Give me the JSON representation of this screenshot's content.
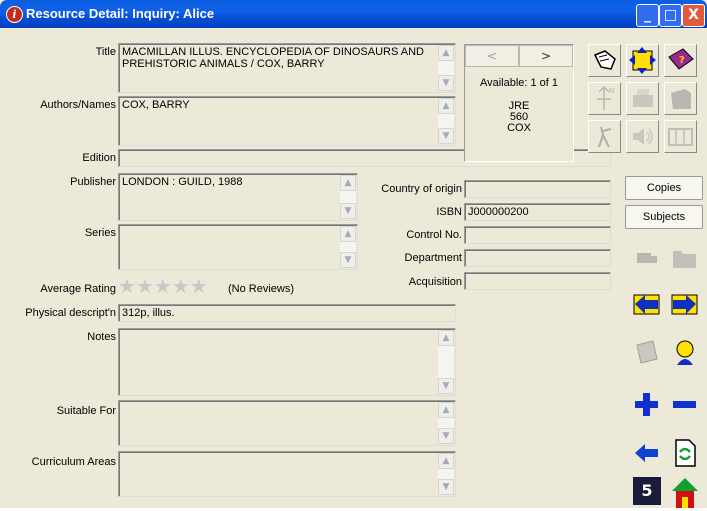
{
  "window": {
    "title": "Resource Detail: Inquiry: Alice",
    "minimize": "_",
    "maximize": "□",
    "close": "X"
  },
  "labels": {
    "title": "Title",
    "authors": "Authors/Names",
    "edition": "Edition",
    "publisher": "Publisher",
    "series": "Series",
    "rating": "Average Rating",
    "physical": "Physical descript'n",
    "notes": "Notes",
    "suitable": "Suitable For",
    "curriculum": "Curriculum Areas",
    "country": "Country of origin",
    "isbn": "ISBN",
    "control": "Control No.",
    "department": "Department",
    "acquisition": "Acquisition"
  },
  "values": {
    "title": "MACMILLAN ILLUS. ENCYCLOPEDIA OF DINOSAURS AND PREHISTORIC ANIMALS / COX, BARRY",
    "authors": "COX, BARRY",
    "edition": "",
    "publisher": "LONDON : GUILD, 1988",
    "series": "",
    "physical": "312p, illus.",
    "notes": "",
    "suitable": "",
    "curriculum": "",
    "country": "",
    "isbn": "J000000200",
    "control": "",
    "department": "",
    "acquisition": ""
  },
  "rating": {
    "stars": 0,
    "max": 5,
    "reviews": "(No Reviews)"
  },
  "availability": {
    "prev": "<",
    "next": ">",
    "text": "Available: 1 of 1",
    "call_line1": "JRE",
    "call_line2": "560",
    "call_line3": "COX"
  },
  "buttons": {
    "copies": "Copies",
    "subjects": "Subjects"
  },
  "icons": {
    "page_number": "5"
  }
}
